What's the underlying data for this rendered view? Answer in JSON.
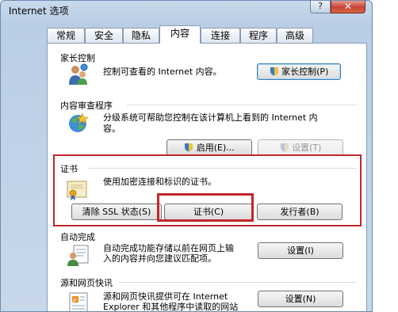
{
  "window": {
    "title": "Internet 选项",
    "help_label": "?",
    "close_label": "✕"
  },
  "tabs": [
    {
      "label": "常规",
      "active": false
    },
    {
      "label": "安全",
      "active": false
    },
    {
      "label": "隐私",
      "active": false
    },
    {
      "label": "内容",
      "active": true
    },
    {
      "label": "连接",
      "active": false
    },
    {
      "label": "程序",
      "active": false
    },
    {
      "label": "高级",
      "active": false
    }
  ],
  "parental": {
    "title": "家长控制",
    "description": "控制可查看的 Internet 内容。",
    "button_label": "家长控制(P)",
    "icon": "parental-control-icon"
  },
  "advisor": {
    "title": "内容审查程序",
    "description_line1": "分级系统可帮助您控制在该计算机上看到的 Internet 内",
    "description_line2": "容。",
    "enable_label": "启用(E)...",
    "settings_label": "设置(T)",
    "icon": "content-advisor-icon"
  },
  "certificates": {
    "title": "证书",
    "description": "使用加密连接和标识的证书。",
    "clear_ssl_label": "清除 SSL 状态(S)",
    "certificates_label": "证书(C)",
    "publishers_label": "发行者(B)",
    "icon": "certificate-icon"
  },
  "autocomplete": {
    "title": "自动完成",
    "description_line1": "自动完成功能存储以前在网页上输",
    "description_line2": "入的内容并向您建议匹配项。",
    "settings_label": "设置(I)",
    "icon": "autocomplete-icon"
  },
  "feeds": {
    "title": "源和网页快讯",
    "description_line1": "源和网页快讯提供可在 Internet",
    "description_line2": "Explorer 和其他程序中读取的网站",
    "settings_label": "设置(N)",
    "icon": "feeds-icon"
  },
  "colors": {
    "highlight": "#c0272d",
    "window_frame": "#b9cde5"
  }
}
